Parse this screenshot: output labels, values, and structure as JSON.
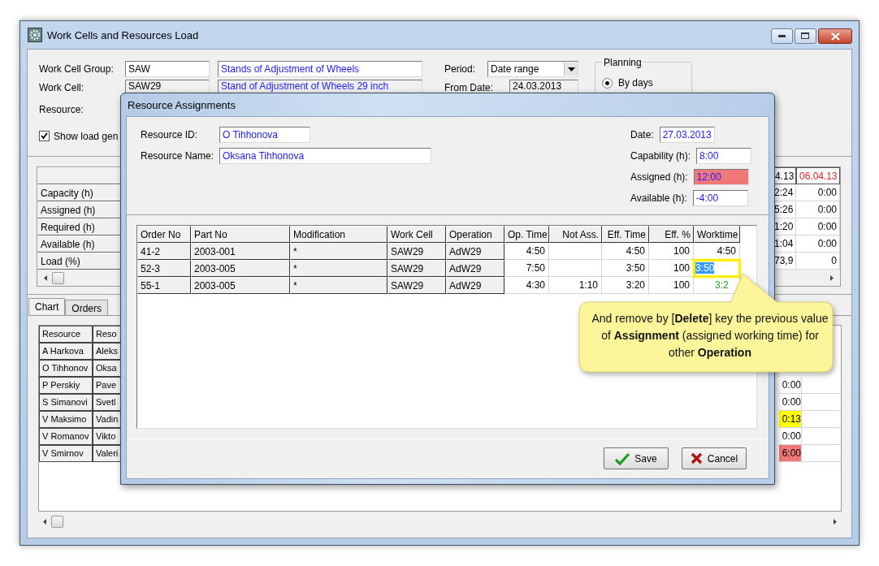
{
  "window": {
    "title": "Work Cells and Resources Load"
  },
  "filters": {
    "work_cell_group": {
      "label": "Work Cell Group:",
      "code": "SAW",
      "name": "Stands of Adjustment of Wheels"
    },
    "work_cell": {
      "label": "Work Cell:",
      "code": "SAW29",
      "name": "Stand of Adjustment of Wheels 29 inch"
    },
    "resource": {
      "label": "Resource:"
    },
    "show_load": {
      "label": "Show load gen",
      "checked": true
    },
    "period": {
      "label": "Period:",
      "value": "Date range"
    },
    "from_date": {
      "label": "From Date:",
      "value": "24.03.2013"
    },
    "planning": {
      "title": "Planning",
      "options": [
        {
          "label": "By days",
          "selected": true
        }
      ]
    }
  },
  "load_grid": {
    "columns": [
      {
        "label": "4.13",
        "weekend": false
      },
      {
        "label": "06.04.13",
        "weekend": true
      }
    ],
    "rows": [
      {
        "label": "Capacity (h)",
        "cells": [
          "2:24",
          "0:00"
        ]
      },
      {
        "label": "Assigned (h)",
        "cells": [
          "5:26",
          "0:00"
        ]
      },
      {
        "label": "Required (h)",
        "cells": [
          "1:20",
          "0:00"
        ]
      },
      {
        "label": "Available (h)",
        "cells": [
          "1:04",
          "0:00"
        ]
      },
      {
        "label": "Load (%)",
        "cells": [
          "73,9",
          "0"
        ]
      }
    ]
  },
  "tabs": [
    {
      "label": "Chart",
      "selected": true
    },
    {
      "label": "Orders",
      "selected": false
    }
  ],
  "resources_table": {
    "columns": [
      "Resource",
      "Reso"
    ],
    "rows": [
      {
        "cells": [
          "A Harkova",
          "Aleks"
        ]
      },
      {
        "cells": [
          "O Tihhonov",
          "Oksa"
        ]
      },
      {
        "cells": [
          "P Perskiy",
          "Pave"
        ],
        "load": {
          "value": "0:00"
        }
      },
      {
        "cells": [
          "S Simanovi",
          "Svetl"
        ],
        "load": {
          "value": "0:00"
        }
      },
      {
        "cells": [
          "V Maksimo",
          "Vadin"
        ],
        "load": {
          "value": "0:13",
          "color": "#ffff00"
        }
      },
      {
        "cells": [
          "V Romanov",
          "Vikto"
        ],
        "load": {
          "value": "0:00"
        }
      },
      {
        "cells": [
          "V Smirnov",
          "Valeri"
        ],
        "load": {
          "value": "6:00",
          "color": "#f07878"
        }
      }
    ]
  },
  "dialog": {
    "title": "Resource Assignments",
    "resource_id": {
      "label": "Resource ID:",
      "value": "O Tihhonova"
    },
    "resource_name": {
      "label": "Resource Name:",
      "value": "Oksana Tihhonova"
    },
    "stats": [
      {
        "label": "Date:",
        "value": "27.03.2013",
        "alert": false
      },
      {
        "label": "Capability (h):",
        "value": "8:00",
        "alert": false
      },
      {
        "label": "Assigned (h):",
        "value": "12:00",
        "alert": true
      },
      {
        "label": "Available (h):",
        "value": "-4:00",
        "alert": false
      }
    ],
    "table": {
      "columns": [
        "Order No",
        "Part No",
        "Modification",
        "Work Cell",
        "Operation",
        "Op. Time",
        "Not Ass.",
        "Eff. Time",
        "Eff. %",
        "Worktime"
      ],
      "rows": [
        {
          "cells": [
            "41-2",
            "2003-001",
            "*",
            "SAW29",
            "AdW29",
            "4:50",
            "",
            "4:50",
            "100"
          ],
          "worktime": "4:50",
          "selected": false,
          "changed": false
        },
        {
          "cells": [
            "52-3",
            "2003-005",
            "*",
            "SAW29",
            "AdW29",
            "7:50",
            "",
            "3:50",
            "100"
          ],
          "worktime": "3:50",
          "selected": true,
          "changed": false
        },
        {
          "cells": [
            "55-1",
            "2003-005",
            "*",
            "SAW29",
            "AdW29",
            "4:30",
            "1:10",
            "3:20",
            "100"
          ],
          "worktime": "3:2",
          "selected": false,
          "changed": true
        }
      ]
    },
    "buttons": [
      {
        "label": "Save",
        "kind": "save"
      },
      {
        "label": "Cancel",
        "kind": "cancel"
      }
    ]
  },
  "callout": {
    "text": "And remove by [**Delete**] key the previous value of **Assignment** (assigned working time) for other **Operation**"
  }
}
